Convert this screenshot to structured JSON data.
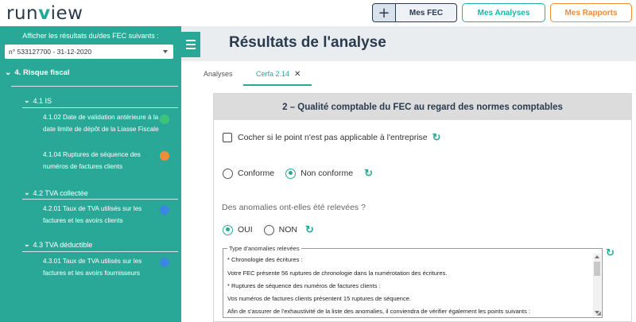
{
  "header": {
    "logo_left": "run",
    "logo_v": "v",
    "logo_right": "iew",
    "plus_label": "+",
    "buttons": {
      "fec": "Mes FEC",
      "analyses": "Mes Analyses",
      "rapports": "Mes Rapports"
    },
    "colors": {
      "navy": "#2a3b4d",
      "teal": "#22b0a8",
      "orange": "#f08b3a"
    }
  },
  "sidebar": {
    "title": "Afficher les résultats du/des FEC suivants :",
    "select_value": "n° 533127700 - 31-12-2020",
    "section": "4. Risque fiscal",
    "groups": [
      {
        "label": "4.1 IS",
        "items": [
          {
            "text": "4.1.02 Date de validation antérieure à la date limite de dépôt de la Liasse Fiscale",
            "dot_color": "#3ec47a"
          },
          {
            "text": "4.1.04 Ruptures de séquence des numéros de factures clients",
            "dot_color": "#f08b3a"
          }
        ]
      },
      {
        "label": "4.2 TVA collectée",
        "items": [
          {
            "text": "4.2.01 Taux de TVA utilisés sur les factures et les avoirs clients",
            "dot_color": "#3a86e0"
          }
        ]
      },
      {
        "label": "4.3 TVA déductible",
        "items": [
          {
            "text": "4.3.01 Taux de TVA utilisés sur les factures et les avoirs fournisseurs",
            "dot_color": "#3a86e0"
          }
        ]
      }
    ]
  },
  "main": {
    "title": "Résultats de l'analyse",
    "tabs": {
      "analyses": "Analyses",
      "cerfa": "Cerfa 2.14",
      "close": "✕"
    },
    "card_title": "2 – Qualité comptable du FEC au regard des normes comptables",
    "not_applicable": "Cocher si le point n'est pas applicable à l'entreprise",
    "radio_conforme": "Conforme",
    "radio_non_conforme": "Non conforme",
    "question": "Des anomalies ont-elles été relevées ?",
    "radio_oui": "OUI",
    "radio_non": "NON",
    "anomalies_legend": "Type d'anomalies relevées",
    "anomalies_lines": [
      "* Chronologie des écritures :",
      "Votre FEC présente 56 ruptures de chronologie dans la numérotation des écritures.",
      "* Ruptures de séquence des numéros de factures clients :",
      "Vos numéros de factures clients présentent 15 ruptures de séquence.",
      "Afin de s'assurer de l'exhaustivité de la liste des anomalies, il conviendra de vérifier également les points suivants :"
    ],
    "refresh_icon": "↻"
  }
}
